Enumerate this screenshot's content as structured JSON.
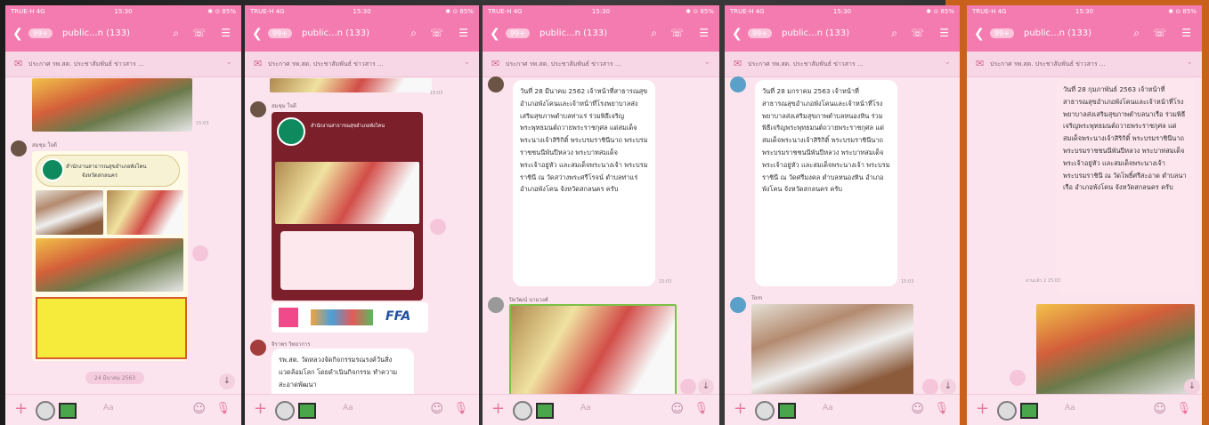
{
  "status_bar": {
    "left": "TRUE-H 4G",
    "time": "15:30",
    "right": "✱ ⊙ 85%"
  },
  "app_bar": {
    "back": "❮",
    "badge": "99+",
    "title": "public...n (133)",
    "search": "⌕",
    "call": "☏",
    "menu": "☰"
  },
  "announcement": {
    "icon": "✉",
    "text": "ประกาศ รพ.สต. ประชาสัมพันธ์ ข่าวสาร ...",
    "chevron": "⌄"
  },
  "input_bar": {
    "plus": "+",
    "placeholder": "Aa",
    "emoji": "☺",
    "mic": "🎙"
  },
  "icons": {
    "back": "back-icon",
    "search": "search-icon",
    "call": "phone-icon",
    "menu": "menu-icon",
    "announcement": "megaphone-icon",
    "plus": "plus-icon",
    "camera": "camera-icon",
    "image": "image-icon",
    "emoji": "emoji-icon",
    "mic": "mic-icon",
    "scroll_down": "chevron-down-icon"
  },
  "panels": [
    {
      "sender": "สมชุม ใจดี",
      "poster_title": "สำนักงานสาธารณสุขอำเภอพังโคน",
      "poster_caption": "จังหวัดสกลนคร",
      "date_pill": "24 มีนาคม 2563",
      "down": "↓"
    },
    {
      "sender": "สมชุม ใจดี",
      "poster_title": "สำนักงานสาธารณสุขอำเภอพังโคน",
      "sender2": "จิราพร วิทยาการ",
      "bubble": "รพ.สต. วัดหลวงจัดกิจกรรมรณรงค์วันสิ่งแวดล้อมโลก โดยดำเนินกิจกรรม ทำความสะอาดพัฒนา",
      "logos": "FFA"
    },
    {
      "bubble": "วันที่ 28 มีนาคม 2562 เจ้าหน้าที่สาธารณสุขอำเภอพังโคนและเจ้าหน้าที่โรงพยาบาลส่งเสริมสุขภาพตำบลท่าแร่ ร่วมพิธีเจริญพระพุทธมนต์ถวายพระราชกุศล แด่สมเด็จพระนางเจ้าสิริกิติ์ พระบรมราชินีนาถ พระบรมราชชนนีพันปีหลวง พระบาทสมเด็จพระเจ้าอยู่หัว และสมเด็จพระนางเจ้า พระบรมราชินี ณ วัดสว่างพระศรีโรจน์ ตำบลท่าแร่ อำเภอพังโคน จังหวัดสกลนคร ครับ",
      "sender": "ปิยวัฒน์ นามวงศ์",
      "down": "↓"
    },
    {
      "bubble": "วันที่ 28 มกราคม 2563 เจ้าหน้าที่สาธารณสุขอำเภอพังโคนและเจ้าหน้าที่โรงพยาบาลส่งเสริมสุขภาพตำบลหนองหิน ร่วมพิธีเจริญพระพุทธมนต์ถวายพระราชกุศล แด่สมเด็จพระนางเจ้าสิริกิติ์ พระบรมราชินีนาถ พระบรมราชชนนีพันปีหลวง พระบาทสมเด็จพระเจ้าอยู่หัว และสมเด็จพระนางเจ้า พระบรมราชินี ณ วัดศรีมงคล ตำบลหนองหิน อำเภอพังโคน จังหวัดสกลนคร ครับ",
      "sender": "Tom",
      "down": "↓"
    },
    {
      "bubble": "วันที่ 28 กุมภาพันธ์ 2563 เจ้าหน้าที่สาธารณสุขอำเภอพังโคนและเจ้าหน้าที่โรงพยาบาลส่งเสริมสุขภาพตำบลนาเรือ ร่วมพิธีเจริญพระพุทธมนต์ถวายพระราชกุศล แด่ สมเด็จพระนางเจ้าสิริกิติ์ พระบรมราชินีนาถ พระบรมราชชนนีพันปีหลวง พระบาทสมเด็จพระเจ้าอยู่หัว และสมเด็จพระนางเจ้า พระบรมราชินี ณ วัดโพธิ์ศรีสะอาด ตำบลนาเรือ อำเภอพังโคน จังหวัดสกลนคร ครับ",
      "time": "อ่านแล้ว 2 15:03",
      "down": "↓"
    }
  ]
}
